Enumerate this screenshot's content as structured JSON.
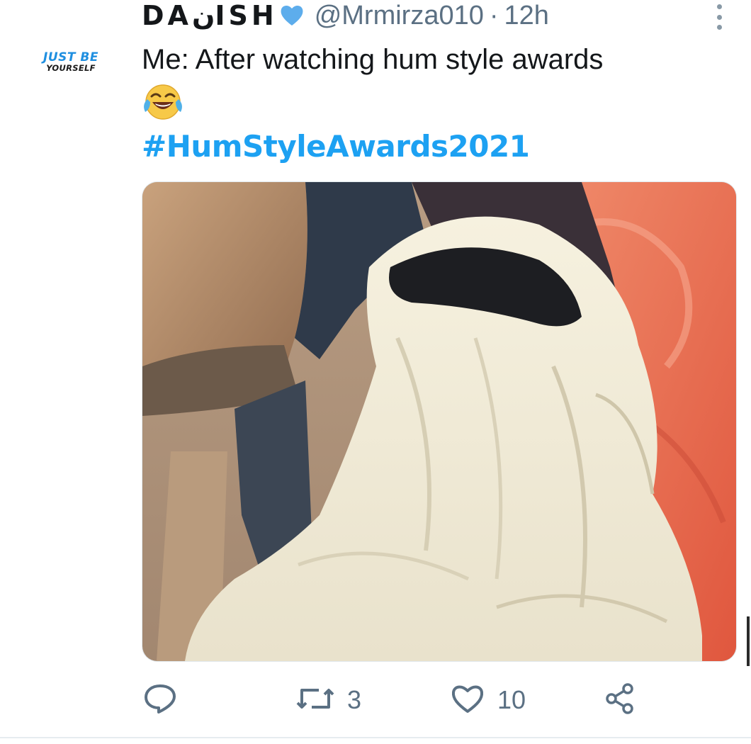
{
  "avatar": {
    "line1": "JUST BE",
    "line2": "YOURSELF"
  },
  "header": {
    "display_name": "DAنISH",
    "verified_icon": "blue-heart-icon",
    "handle": "@Mrmirza010",
    "separator": "·",
    "time": "12h"
  },
  "tweet": {
    "text": "Me: After watching hum style awards",
    "emoji": "face-with-tears-of-joy-icon",
    "hashtag": "#HumStyleAwards2021"
  },
  "media": {
    "description_icon": "tweet-photo"
  },
  "actions": {
    "reply_icon": "reply-icon",
    "retweet_icon": "retweet-icon",
    "retweet_count": "3",
    "like_icon": "heart-outline-icon",
    "like_count": "10",
    "share_icon": "share-icon"
  },
  "colors": {
    "accent": "#1da1f2",
    "muted": "#5b7083",
    "text": "#14171a"
  }
}
